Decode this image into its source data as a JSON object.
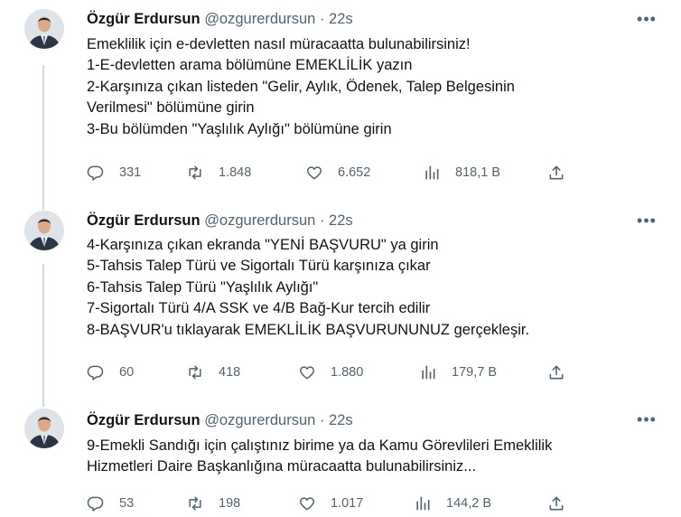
{
  "tweets": [
    {
      "author_name": "Özgür Erdursun",
      "handle": "@ozgurerdursun",
      "separator": "·",
      "time": "22s",
      "more_label": "•••",
      "lines": [
        "Emeklilik için e-devletten nasıl müracaatta bulunabilirsiniz!",
        "1-E-devletten arama bölümüne EMEKLİLİK yazın",
        "2-Karşınıza çıkan listeden \"Gelir, Aylık, Ödenek, Talep Belgesinin",
        "Verilmesi\" bölümüne girin",
        "3-Bu bölümden \"Yaşlılık Aylığı\" bölümüne girin"
      ],
      "replies": "331",
      "retweets": "1.848",
      "likes": "6.652",
      "views": "818,1 B"
    },
    {
      "author_name": "Özgür Erdursun",
      "handle": "@ozgurerdursun",
      "separator": "·",
      "time": "22s",
      "more_label": "•••",
      "lines": [
        "4-Karşınıza çıkan ekranda \"YENİ BAŞVURU\" ya girin",
        "5-Tahsis Talep Türü ve Sigortalı Türü karşınıza çıkar",
        "6-Tahsis Talep Türü \"Yaşlılık Aylığı\"",
        "7-Sigortalı Türü 4/A SSK ve 4/B Bağ-Kur tercih edilir",
        "8-BAŞVUR'u tıklayarak EMEKLİLİK BAŞVURUNUNUZ gerçekleşir."
      ],
      "replies": "60",
      "retweets": "418",
      "likes": "1.880",
      "views": "179,7 B"
    },
    {
      "author_name": "Özgür Erdursun",
      "handle": "@ozgurerdursun",
      "separator": "·",
      "time": "22s",
      "more_label": "•••",
      "lines": [
        "9-Emekli Sandığı için çalıştınız birime ya da Kamu Görevlileri Emeklilik",
        "Hizmetleri Daire Başkanlığına müracaatta bulunabilirsiniz..."
      ],
      "replies": "53",
      "retweets": "198",
      "likes": "1.017",
      "views": "144,2 B"
    }
  ],
  "icons": {
    "reply": "reply-icon",
    "retweet": "retweet-icon",
    "like": "heart-icon",
    "views": "views-icon",
    "share": "share-icon",
    "more": "more-icon"
  },
  "colors": {
    "text": "#0f1419",
    "secondary": "#536471",
    "thread_line": "#cfd9de"
  }
}
